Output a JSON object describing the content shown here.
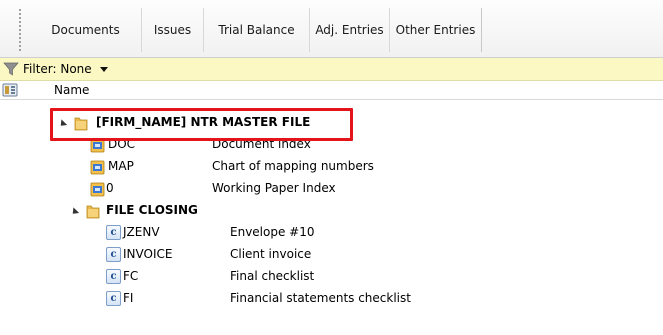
{
  "tabs": [
    {
      "label": "Documents"
    },
    {
      "label": "Issues"
    },
    {
      "label": "Trial Balance"
    },
    {
      "label": "Adj. Entries"
    },
    {
      "label": "Other Entries"
    }
  ],
  "filter": {
    "label": "Filter: None",
    "icon": "funnel-icon",
    "dropdown_icon": "chevron-down-icon"
  },
  "column_header": {
    "label": "Name",
    "icon": "column-chooser-icon"
  },
  "tree": {
    "root": {
      "label": "[FIRM_NAME] NTR MASTER FILE",
      "icon": "folder-icon",
      "expanded": true,
      "highlighted": true,
      "highlight_color": "#e3151a"
    },
    "root_items": [
      {
        "code": "DOC",
        "description": "Document index",
        "icon": "map-document-icon"
      },
      {
        "code": "MAP",
        "description": "Chart of mapping numbers",
        "icon": "map-document-icon"
      },
      {
        "code": "0",
        "description": "Working Paper Index",
        "icon": "map-document-icon"
      }
    ],
    "subfolder": {
      "label": "FILE CLOSING",
      "icon": "folder-icon",
      "expanded": true
    },
    "subfolder_items": [
      {
        "code": "JZENV",
        "description": "Envelope #10",
        "icon": "c-document-icon"
      },
      {
        "code": "INVOICE",
        "description": "Client invoice",
        "icon": "c-document-icon"
      },
      {
        "code": "FC",
        "description": "Final checklist",
        "icon": "c-document-icon"
      },
      {
        "code": "FI",
        "description": "Financial statements checklist",
        "icon": "c-document-icon"
      }
    ]
  },
  "colors": {
    "filter_bar": "#fbf8c4",
    "highlight": "#e3151a",
    "folder": "#e8b94a"
  }
}
